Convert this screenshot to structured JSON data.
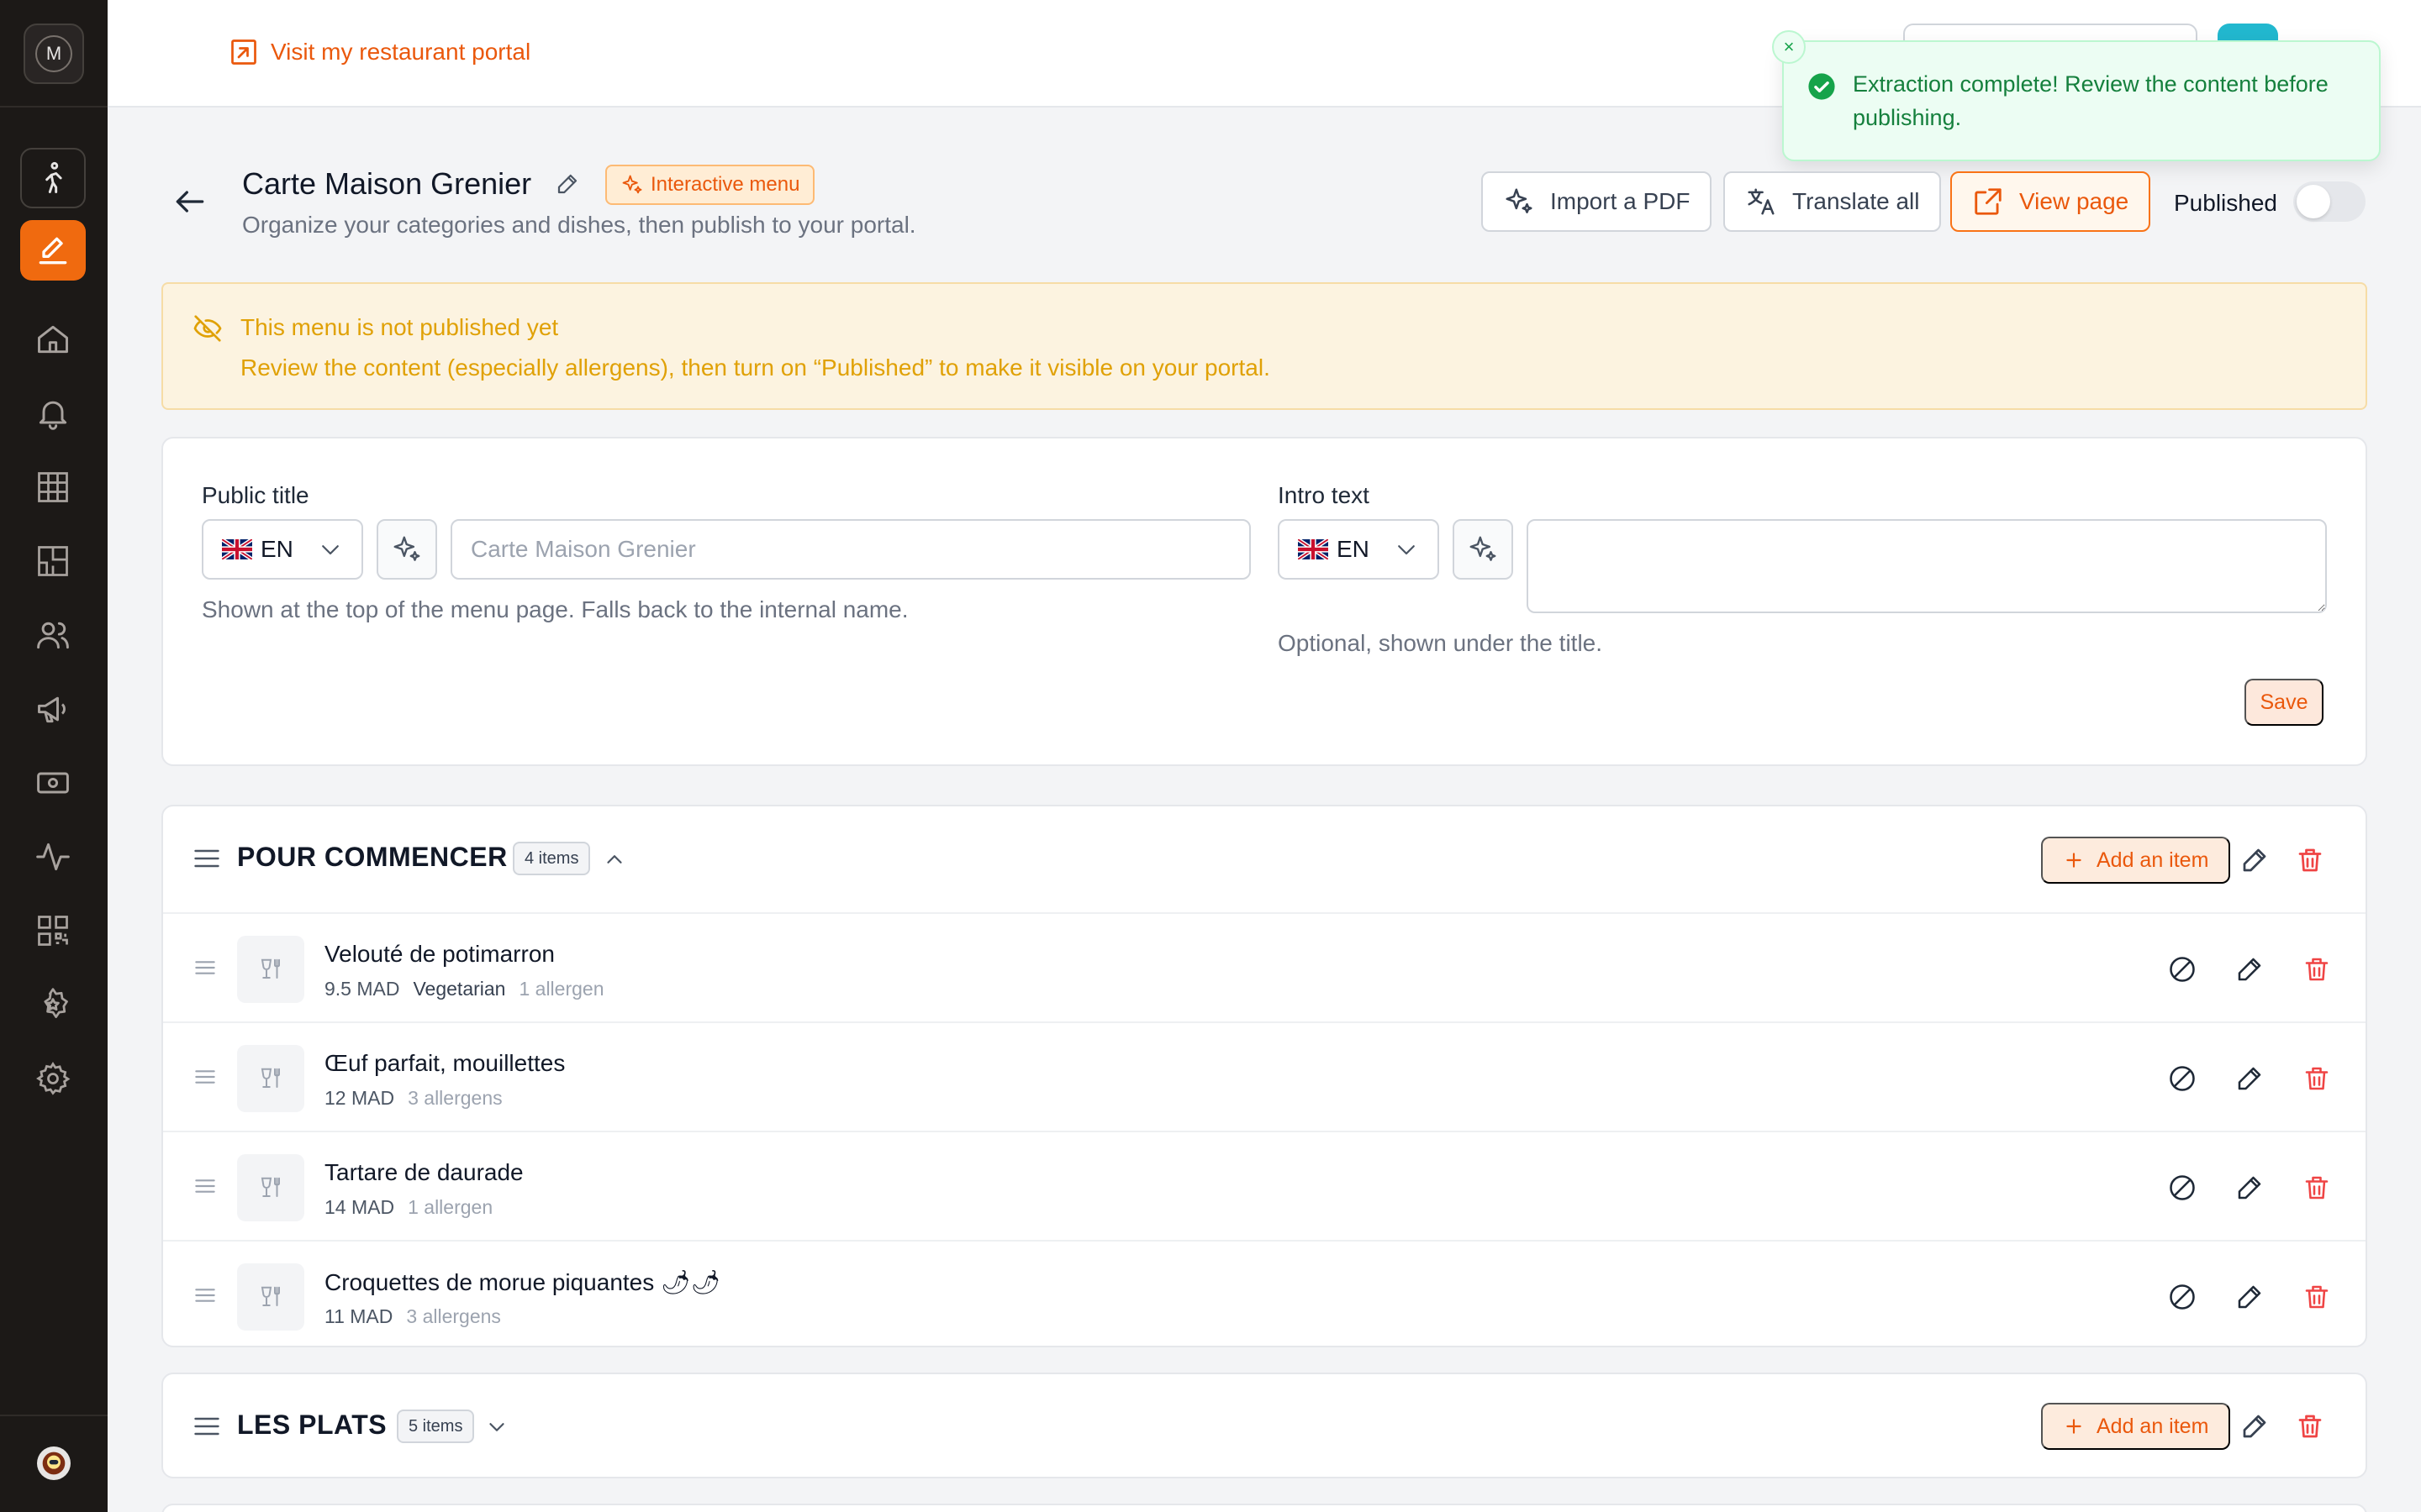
{
  "sidebar": {
    "brand_initial": "M",
    "items": [
      {
        "name": "walk-icon"
      },
      {
        "name": "pencil-icon",
        "active": true
      },
      {
        "name": "home-icon"
      },
      {
        "name": "bell-icon"
      },
      {
        "name": "grid-icon"
      },
      {
        "name": "floorplan-icon"
      },
      {
        "name": "users-icon"
      },
      {
        "name": "megaphone-icon"
      },
      {
        "name": "cash-icon"
      },
      {
        "name": "activity-icon"
      },
      {
        "name": "qr-code-icon"
      },
      {
        "name": "star-badge-icon"
      },
      {
        "name": "settings-icon"
      }
    ]
  },
  "topbar": {
    "portal_link": "Visit my restaurant portal"
  },
  "toast": {
    "message": "Extraction complete! Review the content before publishing.",
    "close_symbol": "×"
  },
  "header": {
    "title": "Carte Maison Grenier",
    "badge": "Interactive menu",
    "subtitle": "Organize your categories and dishes, then publish to your portal.",
    "import_pdf": "Import a PDF",
    "translate_all": "Translate all",
    "view_page": "View page",
    "published_label": "Published",
    "published": false
  },
  "warning": {
    "title": "This menu is not published yet",
    "body": "Review the content (especially allergens), then turn on “Published” to make it visible on your portal."
  },
  "settings": {
    "public_title_label": "Public title",
    "public_title_lang": "EN",
    "public_title_placeholder": "Carte Maison Grenier",
    "public_title_help": "Shown at the top of the menu page. Falls back to the internal name.",
    "intro_label": "Intro text",
    "intro_lang": "EN",
    "intro_help": "Optional, shown under the title.",
    "save": "Save"
  },
  "categories": [
    {
      "title": "POUR COMMENCER",
      "count": "4 items",
      "expanded": true,
      "add_item": "Add an item",
      "items": [
        {
          "name": "Velouté de potimarron",
          "price": "9.5 MAD",
          "tag": "Vegetarian",
          "allergens": "1 allergen"
        },
        {
          "name": "Œuf parfait, mouillettes",
          "price": "12 MAD",
          "tag": "",
          "allergens": "3 allergens"
        },
        {
          "name": "Tartare de daurade",
          "price": "14 MAD",
          "tag": "",
          "allergens": "1 allergen"
        },
        {
          "name": "Croquettes de morue piquantes 🌶🌶",
          "price": "11 MAD",
          "tag": "",
          "allergens": "3 allergens"
        }
      ]
    },
    {
      "title": "LES PLATS",
      "count": "5 items",
      "expanded": false,
      "add_item": "Add an item",
      "items": []
    }
  ],
  "colors": {
    "accent": "#ea580c",
    "sidebar_bg": "#1c1917",
    "success": "#15803d",
    "warning_text": "#e0a106",
    "danger": "#ef4444"
  }
}
